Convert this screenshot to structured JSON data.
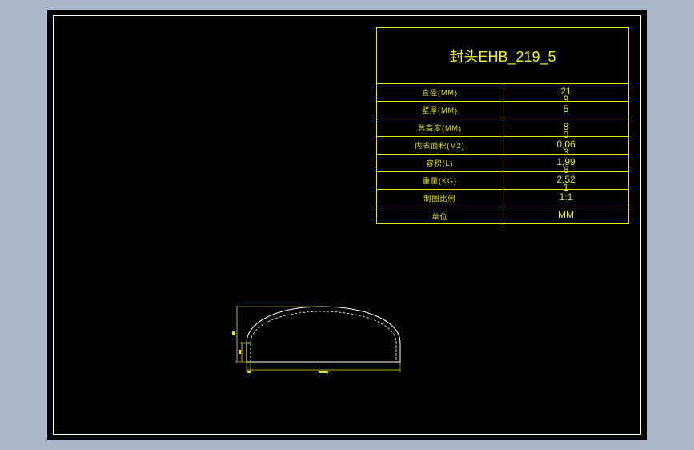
{
  "title_block": {
    "title": "封头EHB_219_5",
    "rows": [
      {
        "label": "直径(MM)",
        "value": "21",
        "value2": "9"
      },
      {
        "label": "壁厚(MM)",
        "value": "5",
        "value2": ""
      },
      {
        "label": "总高度(MM)",
        "value": "8",
        "value2": "0"
      },
      {
        "label": "内表面积(M2)",
        "value": "0,06",
        "value2": "3"
      },
      {
        "label": "容积(L)",
        "value": "1,99",
        "value2": "6"
      },
      {
        "label": "重量(KG)",
        "value": "2,52",
        "value2": "1"
      },
      {
        "label": "制图比例",
        "value": "1:1",
        "value2": ""
      },
      {
        "label": "单位",
        "value": "MM",
        "value2": ""
      }
    ]
  },
  "colors": {
    "background": "#a9b6c8",
    "sheet": "#000000",
    "frame": "#ffffff",
    "table_lines": "#e6e600",
    "dimension_lines": "#e6e600",
    "outline": "#ffffff"
  }
}
